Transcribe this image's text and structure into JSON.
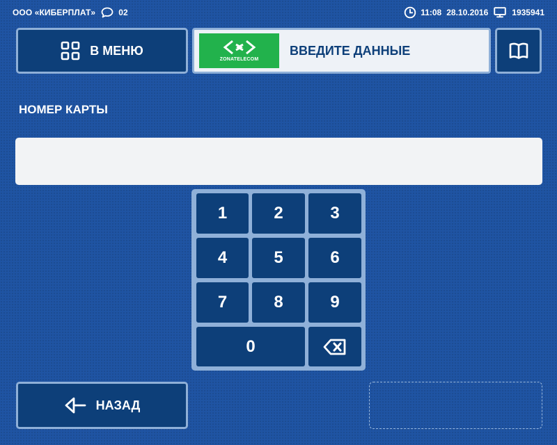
{
  "status_bar": {
    "company": "ООО «КИБЕРПЛАТ»",
    "messages_count": "02",
    "time": "11:08",
    "date": "28.10.2016",
    "terminal_id": "1935941"
  },
  "header": {
    "menu_label": "В МЕНЮ",
    "provider_logo_text": "ZONATELECOM",
    "title": "ВВЕДИТЕ ДАННЫЕ"
  },
  "form": {
    "field_label": "НОМЕР КАРТЫ",
    "field_value": "",
    "field_placeholder": ""
  },
  "keypad": {
    "keys": [
      "1",
      "2",
      "3",
      "4",
      "5",
      "6",
      "7",
      "8",
      "9",
      "0"
    ]
  },
  "footer": {
    "back_label": "НАЗАД"
  },
  "colors": {
    "background": "#1f54a3",
    "button_fill": "#0d3f79",
    "button_border": "#8fb0d8",
    "logo_green": "#22b24c",
    "panel_light": "#eef2f7"
  }
}
